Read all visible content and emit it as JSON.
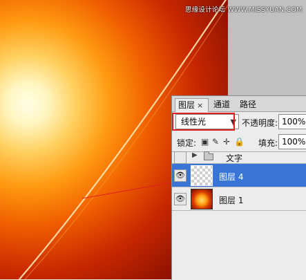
{
  "watermark": "思缘设计论坛 WWW.MISSYUAN.COM",
  "layers_panel": {
    "tabs": [
      {
        "label": "图层",
        "close": "×",
        "active": true
      },
      {
        "label": "通道",
        "active": false
      },
      {
        "label": "路径",
        "active": false
      }
    ],
    "blend_mode": "线性光",
    "opacity_label": "不透明度:",
    "opacity_value": "100%",
    "lock_label": "锁定:",
    "fill_label": "填充:",
    "fill_value": "100%",
    "layers": [
      {
        "name": "文字",
        "type": "group",
        "visible": false,
        "selected": false
      },
      {
        "name": "图层 4",
        "type": "layer",
        "visible": true,
        "selected": true
      },
      {
        "name": "图层 1",
        "type": "layer",
        "visible": true,
        "selected": false
      }
    ]
  },
  "colors": {
    "selection": "#3875d7",
    "annotation": "#e02020"
  }
}
